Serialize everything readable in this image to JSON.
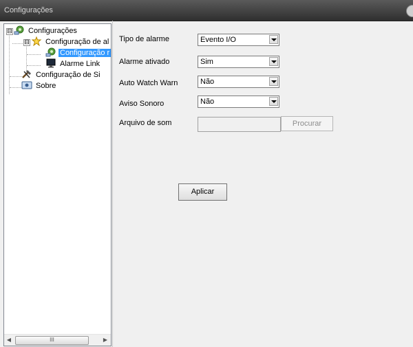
{
  "window": {
    "title": "Configurações"
  },
  "tree": {
    "items": [
      {
        "label": "Configurações",
        "icon": "settings-gear-icon"
      },
      {
        "label": "Configuração de al",
        "icon": "alarm-star-icon"
      },
      {
        "label": "Configuração r",
        "icon": "config-gear-icon",
        "selected": true
      },
      {
        "label": "Alarme Link",
        "icon": "monitor-icon"
      },
      {
        "label": "Configuração de Si",
        "icon": "tools-icon"
      },
      {
        "label": "Sobre",
        "icon": "about-icon"
      }
    ],
    "expanders": [
      "⊟",
      "⊟"
    ],
    "scrollbar_thumb": "III"
  },
  "form": {
    "tipo_label": "Tipo de alarme",
    "tipo_value": "Evento I/O",
    "ativado_label": "Alarme ativado",
    "ativado_value": "Sim",
    "autowatch_label": "Auto Watch Warn",
    "autowatch_value": "Não",
    "aviso_label": "Aviso Sonoro",
    "aviso_value": "Não",
    "arquivo_label": "Arquivo de som",
    "arquivo_value": "",
    "browse_label": "Procurar",
    "apply_label": "Aplicar"
  }
}
